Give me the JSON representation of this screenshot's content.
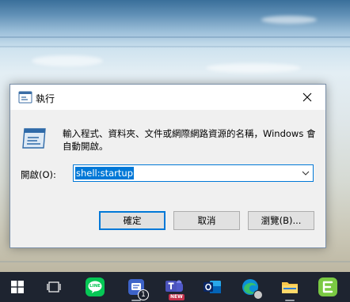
{
  "dialog": {
    "title": "執行",
    "description": "輸入程式、資料夾、文件或網際網路資源的名稱，Windows 會自動開啟。",
    "open_label": "開啟(O):",
    "open_value": "shell:startup",
    "ok_label": "確定",
    "cancel_label": "取消",
    "browse_label": "瀏覽(B)..."
  },
  "taskbar": {
    "items": [
      {
        "name": "start",
        "icon": "windows-logo-icon"
      },
      {
        "name": "task-view",
        "icon": "task-view-icon"
      },
      {
        "name": "line",
        "icon": "line-app-icon",
        "label": "LINE"
      },
      {
        "name": "chat",
        "icon": "chat-app-icon",
        "badge": "1"
      },
      {
        "name": "teams",
        "icon": "teams-icon",
        "label": "NEW"
      },
      {
        "name": "outlook",
        "icon": "outlook-icon"
      },
      {
        "name": "edge",
        "icon": "edge-browser-icon"
      },
      {
        "name": "file-explorer",
        "icon": "folder-icon"
      },
      {
        "name": "evernote",
        "icon": "evernote-icon"
      }
    ]
  },
  "colors": {
    "accent": "#0078d7",
    "taskbar": "#1e2430",
    "dialog_bg": "#f0f0f0"
  }
}
